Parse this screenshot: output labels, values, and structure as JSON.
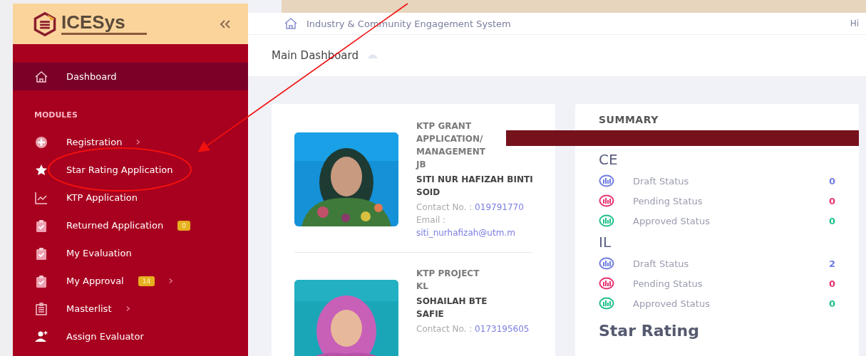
{
  "logo": {
    "text": "ICESys"
  },
  "sidebar": {
    "section": "MODULES",
    "items": [
      {
        "label": "Dashboard",
        "selected": true,
        "submenu": false
      },
      {
        "label": "Registration",
        "selected": false,
        "submenu": true
      },
      {
        "label": "Star Rating Application",
        "selected": false,
        "submenu": false
      },
      {
        "label": "KTP Application",
        "selected": false,
        "submenu": false
      },
      {
        "label": "Returned Application",
        "selected": false,
        "badge": "0",
        "submenu": false
      },
      {
        "label": "My Evaluation",
        "selected": false,
        "submenu": false
      },
      {
        "label": "My Approval",
        "selected": false,
        "badge": "14",
        "submenu": true
      },
      {
        "label": "Masterlist",
        "selected": false,
        "submenu": true
      },
      {
        "label": "Assign Evaluator",
        "selected": false,
        "submenu": false
      }
    ]
  },
  "header": {
    "title": "Industry & Community Engagement System",
    "greeting": "Hi"
  },
  "breadcrumb": {
    "title": "Main Dashboard"
  },
  "contacts": [
    {
      "program": [
        "KTP GRANT",
        "APPLICATION/",
        "MANAGEMENT"
      ],
      "location": "JB",
      "name": [
        "SITI NUR HAFIZAH BINTI",
        "SOID"
      ],
      "contact_label": "Contact No. :",
      "contact": "019791770",
      "email_label": "Email :",
      "email": "siti_nurhafizah@utm.m"
    },
    {
      "program": [
        "KTP PROJECT"
      ],
      "location": "KL",
      "name": [
        "SOHAILAH BTE",
        "SAFIE"
      ],
      "contact_label": "Contact No. :",
      "contact": "0173195605"
    }
  ],
  "summary": {
    "title": "SUMMARY",
    "groups": [
      {
        "title": "CE",
        "rows": [
          {
            "label": "Draft Status",
            "value": "0",
            "color": "#6f7de0"
          },
          {
            "label": "Pending Status",
            "value": "0",
            "color": "#e8336f"
          },
          {
            "label": "Approved Status",
            "value": "0",
            "color": "#1fc08a"
          }
        ]
      },
      {
        "title": "IL",
        "rows": [
          {
            "label": "Draft Status",
            "value": "2",
            "color": "#6f7de0"
          },
          {
            "label": "Pending Status",
            "value": "0",
            "color": "#e8336f"
          },
          {
            "label": "Approved Status",
            "value": "0",
            "color": "#1fc08a"
          }
        ]
      }
    ],
    "footer": "Star Rating"
  }
}
